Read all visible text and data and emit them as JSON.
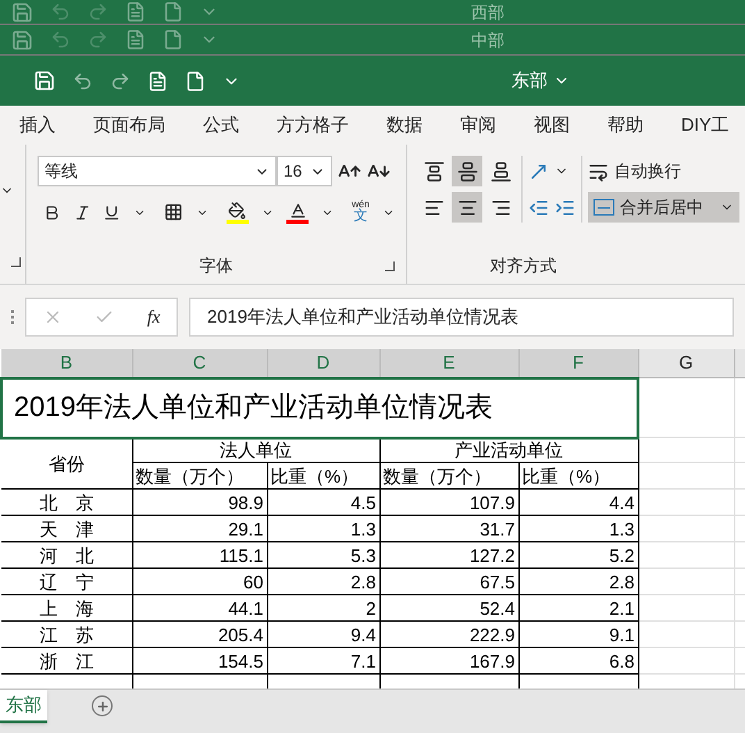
{
  "background_windows": [
    {
      "title": "西部"
    },
    {
      "title": "中部"
    }
  ],
  "title_bar": {
    "title": "东部"
  },
  "ribbon_tabs": [
    {
      "label": "插入",
      "selected": false
    },
    {
      "label": "页面布局",
      "selected": false
    },
    {
      "label": "公式",
      "selected": false
    },
    {
      "label": "方方格子",
      "selected": false
    },
    {
      "label": "数据",
      "selected": false
    },
    {
      "label": "审阅",
      "selected": false
    },
    {
      "label": "视图",
      "selected": false
    },
    {
      "label": "帮助",
      "selected": false
    },
    {
      "label": "DIY工",
      "selected": false
    }
  ],
  "font_group": {
    "label": "字体",
    "font_name": "等线",
    "font_size": "16",
    "phonetic_top": "wén",
    "phonetic_bottom": "文"
  },
  "align_group": {
    "label": "对齐方式",
    "wrap_text": "自动换行",
    "merge_center": {
      "label": "合并后居中",
      "on": true
    },
    "vertical": [
      {
        "kind": "top",
        "selected": false
      },
      {
        "kind": "middle",
        "selected": true
      },
      {
        "kind": "bottom",
        "selected": false
      }
    ],
    "horizontal": [
      {
        "kind": "left",
        "selected": false
      },
      {
        "kind": "center",
        "selected": true
      },
      {
        "kind": "right",
        "selected": false
      }
    ]
  },
  "formula_bar": {
    "function_label": "fx",
    "value": "2019年法人单位和产业活动单位情况表"
  },
  "column_headers": [
    {
      "label": "B",
      "selected": true
    },
    {
      "label": "C",
      "selected": true
    },
    {
      "label": "D",
      "selected": true
    },
    {
      "label": "E",
      "selected": true
    },
    {
      "label": "F",
      "selected": true
    },
    {
      "label": "G",
      "selected": false
    }
  ],
  "sheet": {
    "title": "2019年法人单位和产业活动单位情况表",
    "province_header": "省份",
    "group_headers": [
      "法人单位",
      "产业活动单位"
    ],
    "sub_headers": [
      "数量（万个）",
      "比重（%）",
      "数量（万个）",
      "比重（%）"
    ],
    "rows": [
      {
        "province": "北　京",
        "values": [
          "98.9",
          "4.5",
          "107.9",
          "4.4"
        ]
      },
      {
        "province": "天　津",
        "values": [
          "29.1",
          "1.3",
          "31.7",
          "1.3"
        ]
      },
      {
        "province": "河　北",
        "values": [
          "115.1",
          "5.3",
          "127.2",
          "5.2"
        ]
      },
      {
        "province": "辽　宁",
        "values": [
          "60",
          "2.8",
          "67.5",
          "2.8"
        ]
      },
      {
        "province": "上　海",
        "values": [
          "44.1",
          "2",
          "52.4",
          "2.1"
        ]
      },
      {
        "province": "江　苏",
        "values": [
          "205.4",
          "9.4",
          "222.9",
          "9.1"
        ]
      },
      {
        "province": "浙　江",
        "values": [
          "154.5",
          "7.1",
          "167.9",
          "6.8"
        ]
      }
    ]
  },
  "sheet_tabs": [
    {
      "label": "东部",
      "selected": true
    }
  ]
}
